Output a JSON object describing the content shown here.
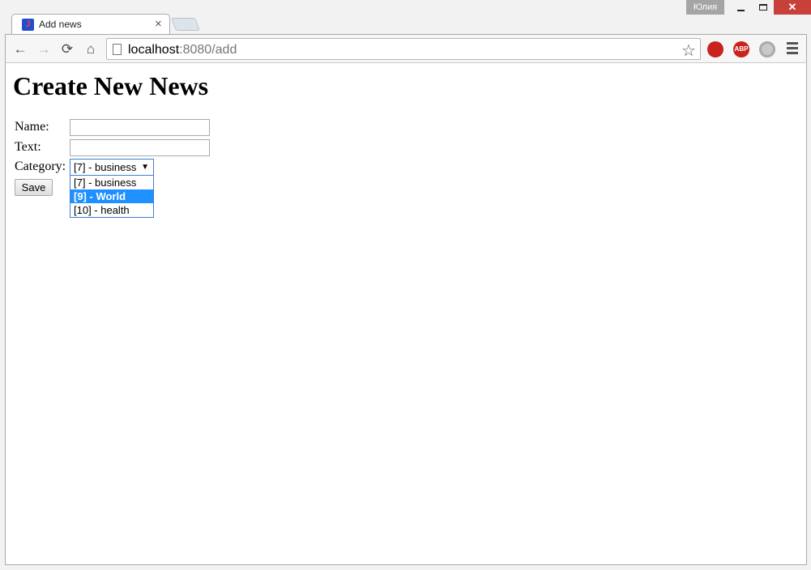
{
  "window": {
    "profile_name": "Юлия",
    "minimize_icon": "minimize-icon",
    "maximize_icon": "maximize-icon",
    "close_glyph": "✕"
  },
  "tab": {
    "title": "Add news",
    "close_glyph": "×",
    "favicon_glyph": "J"
  },
  "toolbar": {
    "back_glyph": "←",
    "forward_glyph": "→",
    "reload_glyph": "⟳",
    "home_glyph": "⌂",
    "url_host": "localhost",
    "url_rest": ":8080/add",
    "star_glyph": "☆",
    "ext_ublock": "",
    "ext_abp": "ABP"
  },
  "page": {
    "title": "Create New News",
    "form": {
      "name_label": "Name:",
      "name_value": "",
      "text_label": "Text:",
      "text_value": "",
      "category_label": "Category:",
      "category_selected": "[7] - business",
      "save_label": "Save"
    },
    "dropdown_options": [
      {
        "label": "[7] - business",
        "highlighted": false
      },
      {
        "label": "[9] - World",
        "highlighted": true
      },
      {
        "label": "[10] - health",
        "highlighted": false
      }
    ]
  },
  "colors": {
    "highlight": "#1e90ff",
    "close_button": "#c7403a",
    "select_border": "#3c7fd9"
  }
}
